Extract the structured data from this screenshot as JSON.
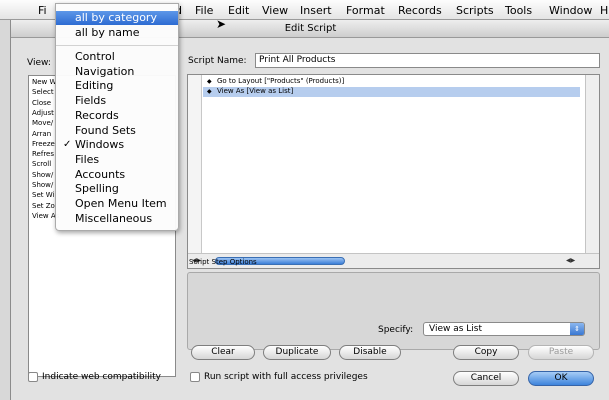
{
  "menubar": {
    "items": [
      "Fi",
      "d",
      "File",
      "Edit",
      "View",
      "Insert",
      "Format",
      "Records",
      "Scripts",
      "Tools",
      "Window",
      "H"
    ]
  },
  "window": {
    "title": "Edit Script"
  },
  "view_label": "View:",
  "step_list": [
    "New W",
    "Select",
    "Close",
    "Adjust",
    "Move/",
    "Arran",
    "Freeze",
    "Refres",
    "Scroll",
    "Show/",
    "Show/",
    "Set Wi",
    "Set Zo",
    "View As"
  ],
  "script_name": {
    "label": "Script Name:",
    "value": "Print All Products"
  },
  "steps": [
    {
      "text": "Go to Layout [\"Products\" (Products)]",
      "selected": false
    },
    {
      "text": "View As [View as List]",
      "selected": true
    }
  ],
  "options": {
    "title": "Script Step Options",
    "specify_label": "Specify:",
    "specify_value": "View as List"
  },
  "buttons": {
    "clear": "Clear",
    "duplicate": "Duplicate",
    "disable": "Disable",
    "copy": "Copy",
    "paste": "Paste",
    "cancel": "Cancel",
    "ok": "OK"
  },
  "checkboxes": {
    "web_compat": "Indicate web compatibility",
    "full_access": "Run script with full access privileges"
  },
  "dropdown": {
    "top": [
      "all by category",
      "all by name"
    ],
    "categories": [
      "Control",
      "Navigation",
      "Editing",
      "Fields",
      "Records",
      "Found Sets",
      "Windows",
      "Files",
      "Accounts",
      "Spelling",
      "Open Menu Item",
      "Miscellaneous"
    ],
    "highlighted": "all by category",
    "checked": "Windows"
  },
  "colors": {
    "accent": "#2d6bd2",
    "selection": "#b6cdee"
  }
}
